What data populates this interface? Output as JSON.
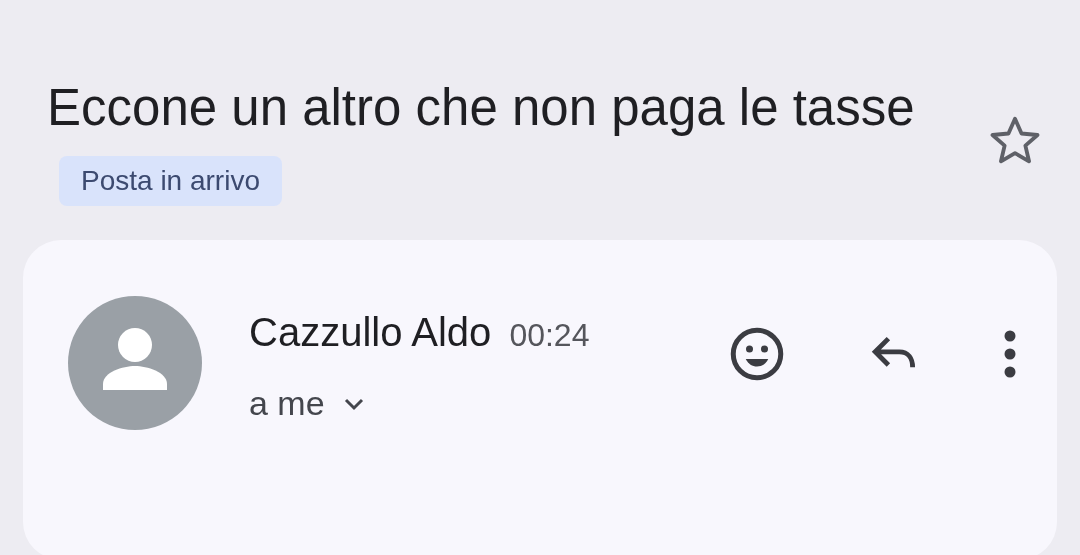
{
  "message": {
    "subject": "Eccone un altro che non paga le tasse",
    "label": "Posta in arrivo",
    "starred": false
  },
  "email": {
    "sender": "Cazzullo Aldo",
    "time": "00:24",
    "recipients": "a me"
  }
}
